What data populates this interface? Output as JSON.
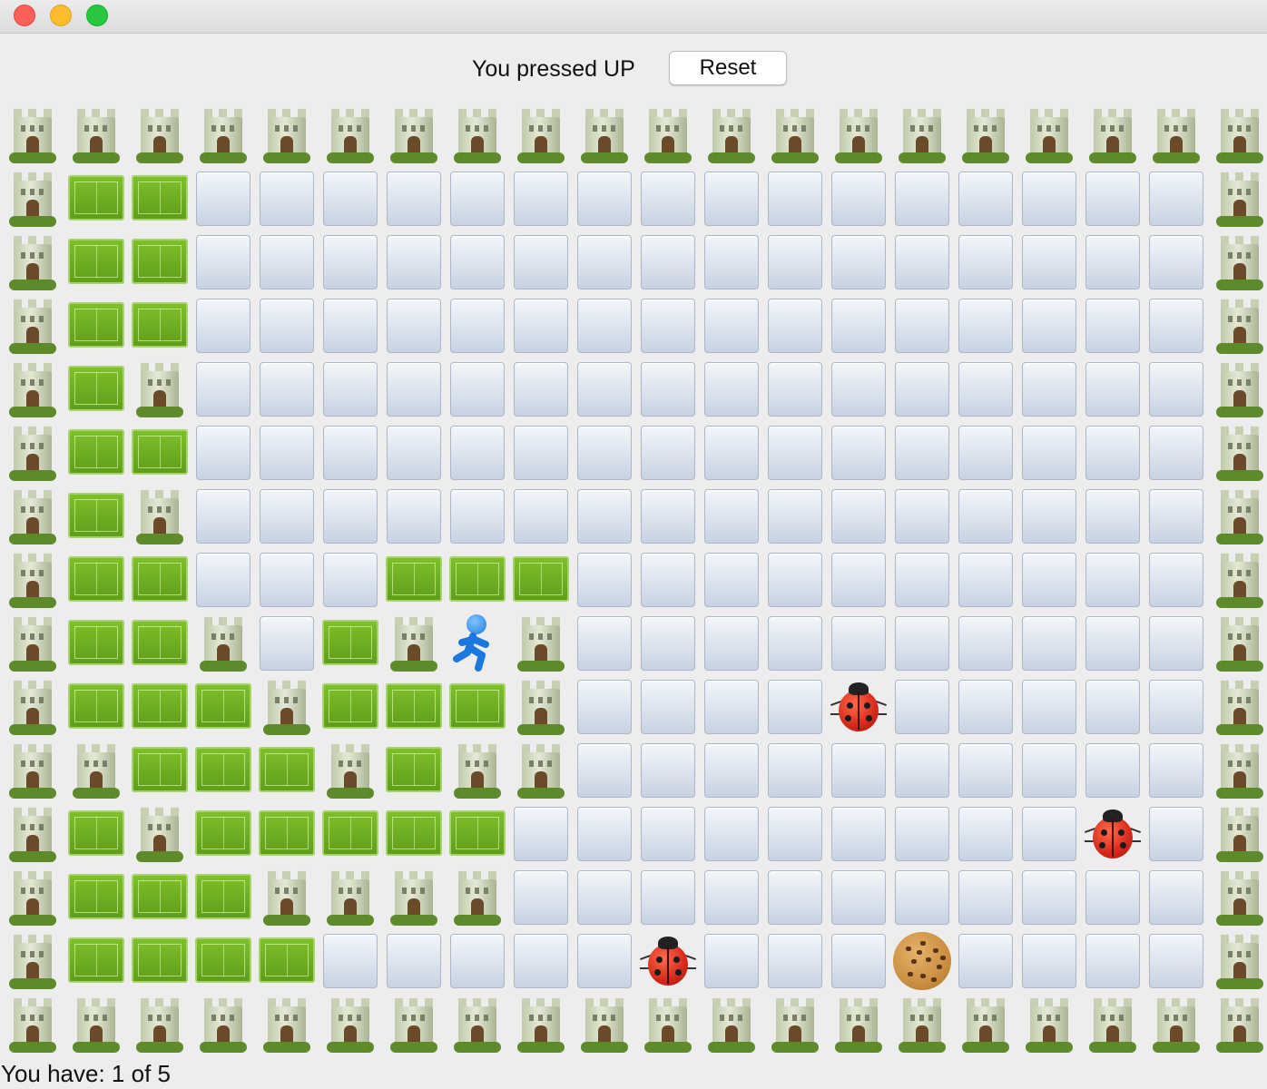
{
  "window": {
    "controls": [
      "close",
      "minimize",
      "maximize"
    ]
  },
  "header": {
    "status": "You pressed UP",
    "reset_label": "Reset"
  },
  "footer": {
    "text": "You have: 1 of 5"
  },
  "board": {
    "columns": 20,
    "rows": 15,
    "legend": {
      "T": "tower-wall",
      "F": "grass-field",
      ".": "empty-floor",
      "P": "player-runner",
      "B": "ladybug",
      "C": "cookie"
    },
    "grid": [
      "TTTTTTTTTTTTTTTTTTTT",
      "TFF................T",
      "TFF................T",
      "TFF................T",
      "TFT................T",
      "TFF................T",
      "TFT................T",
      "TFF...FFF..........T",
      "TFFT.FTPT..........T",
      "TFFFTFFFT....B.....T",
      "TTFFFTFTT..........T",
      "TFTFFFFF.........B.T",
      "TFFFTTTT...........T",
      "TFFFF.....B...C....T",
      "TTTTTTTTTTTTTTTTTTTT"
    ]
  }
}
